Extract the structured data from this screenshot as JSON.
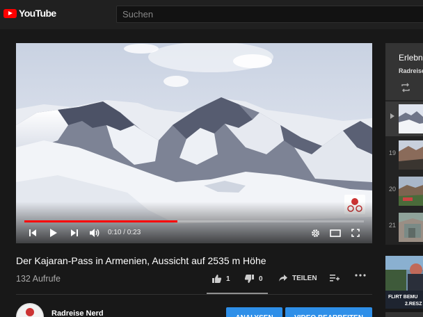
{
  "header": {
    "logo_text": "YouTube",
    "search_placeholder": "Suchen"
  },
  "player": {
    "current_time": "0:10",
    "duration": "0:23",
    "time_display": "0:10 / 0:23",
    "progress_fraction": 0.45,
    "accent_color": "#ff0000"
  },
  "video": {
    "title": "Der Kajaran-Pass in Armenien, Aussicht auf 2535 m Höhe",
    "views": "132 Aufrufe",
    "likes": "1",
    "dislikes": "0",
    "share_label": "TEILEN"
  },
  "channel": {
    "name": "Radreise Nerd",
    "analytics_label": "ANALYSEN",
    "edit_label": "VIDEO BEARBEITEN",
    "button_color": "#2e8fe8"
  },
  "playlist": {
    "title": "Erlebni",
    "owner": "Radreise",
    "items": [
      {
        "index": ""
      },
      {
        "index": "19"
      },
      {
        "index": "20"
      },
      {
        "index": "21"
      }
    ]
  },
  "recommendation": {
    "overlay_text_1": "FLIRT BEMU",
    "overlay_text_2": "2.RESZ"
  }
}
